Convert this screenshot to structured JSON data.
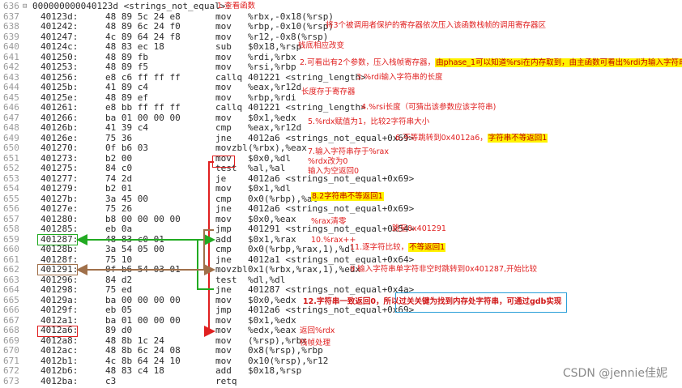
{
  "header": {
    "line": "636",
    "fold": "⊟",
    "text": "000000000040123d <strings_not_equal>:"
  },
  "rows": [
    {
      "ln": "637",
      "addr": "40123d:",
      "bytes": "48 89 5c 24 e8",
      "mn": "mov",
      "op": "%rbx,-0x18(%rsp)"
    },
    {
      "ln": "638",
      "addr": "401242:",
      "bytes": "48 89 6c 24 f0",
      "mn": "mov",
      "op": "%rbp,-0x10(%rsp)"
    },
    {
      "ln": "639",
      "addr": "401247:",
      "bytes": "4c 89 64 24 f8",
      "mn": "mov",
      "op": "%r12,-0x8(%rsp)"
    },
    {
      "ln": "640",
      "addr": "40124c:",
      "bytes": "48 83 ec 18",
      "mn": "sub",
      "op": "$0x18,%rsp"
    },
    {
      "ln": "641",
      "addr": "401250:",
      "bytes": "48 89 fb",
      "mn": "mov",
      "op": "%rdi,%rbx"
    },
    {
      "ln": "642",
      "addr": "401253:",
      "bytes": "48 89 f5",
      "mn": "mov",
      "op": "%rsi,%rbp"
    },
    {
      "ln": "643",
      "addr": "401256:",
      "bytes": "e8 c6 ff ff ff",
      "mn": "callq",
      "op": "401221 <string_length>"
    },
    {
      "ln": "644",
      "addr": "40125b:",
      "bytes": "41 89 c4",
      "mn": "mov",
      "op": "%eax,%r12d"
    },
    {
      "ln": "645",
      "addr": "40125e:",
      "bytes": "48 89 ef",
      "mn": "mov",
      "op": "%rbp,%rdi"
    },
    {
      "ln": "646",
      "addr": "401261:",
      "bytes": "e8 bb ff ff ff",
      "mn": "callq",
      "op": "401221 <string_length>"
    },
    {
      "ln": "647",
      "addr": "401266:",
      "bytes": "ba 01 00 00 00",
      "mn": "mov",
      "op": "$0x1,%edx"
    },
    {
      "ln": "648",
      "addr": "40126b:",
      "bytes": "41 39 c4",
      "mn": "cmp",
      "op": "%eax,%r12d"
    },
    {
      "ln": "649",
      "addr": "40126e:",
      "bytes": "75 36",
      "mn": "jne",
      "op": "4012a6 <strings_not_equal+0x69>"
    },
    {
      "ln": "650",
      "addr": "401270:",
      "bytes": "0f b6 03",
      "mn": "movzbl",
      "op": "(%rbx),%eax"
    },
    {
      "ln": "651",
      "addr": "401273:",
      "bytes": "b2 00",
      "mn": "mov",
      "op": "$0x0,%dl"
    },
    {
      "ln": "652",
      "addr": "401275:",
      "bytes": "84 c0",
      "mn": "test",
      "op": "%al,%al"
    },
    {
      "ln": "653",
      "addr": "401277:",
      "bytes": "74 2d",
      "mn": "je",
      "op": "4012a6 <strings_not_equal+0x69>"
    },
    {
      "ln": "654",
      "addr": "401279:",
      "bytes": "b2 01",
      "mn": "mov",
      "op": "$0x1,%dl"
    },
    {
      "ln": "655",
      "addr": "40127b:",
      "bytes": "3a 45 00",
      "mn": "cmp",
      "op": "0x0(%rbp),%al"
    },
    {
      "ln": "656",
      "addr": "40127e:",
      "bytes": "75 26",
      "mn": "jne",
      "op": "4012a6 <strings_not_equal+0x69>"
    },
    {
      "ln": "657",
      "addr": "401280:",
      "bytes": "b8 00 00 00 00",
      "mn": "mov",
      "op": "$0x0,%eax"
    },
    {
      "ln": "658",
      "addr": "401285:",
      "bytes": "eb 0a",
      "mn": "jmp",
      "op": "401291 <strings_not_equal+0x54>"
    },
    {
      "ln": "659",
      "addr": "401287:",
      "bytes": "48 83 c0 01",
      "mn": "add",
      "op": "$0x1,%rax"
    },
    {
      "ln": "660",
      "addr": "40128b:",
      "bytes": "3a 54 05 00",
      "mn": "cmp",
      "op": "0x0(%rbp,%rax,1),%dl"
    },
    {
      "ln": "661",
      "addr": "40128f:",
      "bytes": "75 10",
      "mn": "jne",
      "op": "4012a1 <strings_not_equal+0x64>"
    },
    {
      "ln": "662",
      "addr": "401291:",
      "bytes": "0f b6 54 03 01",
      "mn": "movzbl",
      "op": "0x1(%rbx,%rax,1),%edx"
    },
    {
      "ln": "663",
      "addr": "401296:",
      "bytes": "84 d2",
      "mn": "test",
      "op": "%dl,%dl"
    },
    {
      "ln": "664",
      "addr": "401298:",
      "bytes": "75 ed",
      "mn": "jne",
      "op": "401287 <strings_not_equal+0x4a>"
    },
    {
      "ln": "665",
      "addr": "40129a:",
      "bytes": "ba 00 00 00 00",
      "mn": "mov",
      "op": "$0x0,%edx"
    },
    {
      "ln": "666",
      "addr": "40129f:",
      "bytes": "eb 05",
      "mn": "jmp",
      "op": "4012a6 <strings_not_equal+0x69>"
    },
    {
      "ln": "667",
      "addr": "4012a1:",
      "bytes": "ba 01 00 00 00",
      "mn": "mov",
      "op": "$0x1,%edx"
    },
    {
      "ln": "668",
      "addr": "4012a6:",
      "bytes": "89 d0",
      "mn": "mov",
      "op": "%edx,%eax"
    },
    {
      "ln": "669",
      "addr": "4012a8:",
      "bytes": "48 8b 1c 24",
      "mn": "mov",
      "op": "(%rsp),%rbx"
    },
    {
      "ln": "670",
      "addr": "4012ac:",
      "bytes": "48 8b 6c 24 08",
      "mn": "mov",
      "op": "0x8(%rsp),%rbp"
    },
    {
      "ln": "671",
      "addr": "4012b1:",
      "bytes": "4c 8b 64 24 10",
      "mn": "mov",
      "op": "0x10(%rsp),%r12"
    },
    {
      "ln": "672",
      "addr": "4012b6:",
      "bytes": "48 83 c4 18",
      "mn": "add",
      "op": "$0x18,%rsp"
    },
    {
      "ln": "673",
      "addr": "4012ba:",
      "bytes": "c3",
      "mn": "retq",
      "op": ""
    }
  ],
  "annotations": {
    "a1": "1.查看函数",
    "a2": "将3个被调用者保护的寄存器依次压入该函数栈帧的调用寄存器区",
    "a3": "栈底相应改变",
    "a4_pre": "2.可看出有2个参数，压入栈帧寄存器，",
    "a4_hl": "由phase_1可以知道%rsi在内存取到，由主函数可看出%rdi为输入字符串",
    "a5": "3.%rdi输入字符串的长度",
    "a6": "长度存于寄存器",
    "a7": "4.%rsi长度（可猜出该参数应该字符串)",
    "a8": "5.%rdx赋值为1，比较2字符串大小",
    "a9_pre": "6.不等跳转到0x4012a6，",
    "a9_hl": "字符串不等返回1",
    "a10": "7.输入字符串存于%rax",
    "a11": "%rdx改为0",
    "a12": "输入为空返回0",
    "a13": "8.2字符串不等返回1",
    "a14": "%rax清零",
    "a15": "跳至0x401291",
    "a16": "10.%rax++",
    "a17_pre": "11.逐字符比较，",
    "a17_hl": "不等返回1",
    "a18": "9.输入字符串单字符非空时跳转到0x401287,开始比较",
    "a19": "12.字符串一致返回0，所以过关关键为找到内存处字符串，可通过gdb实现",
    "a20": "返回%rdx",
    "a21": "栈帧处理"
  },
  "colors": {
    "annotation": "#e02020",
    "highlight": "#fff200",
    "green": "#22aa22",
    "brown": "#a0704a",
    "blue": "#2a9fd8"
  },
  "watermark": "CSDN @jennie佳妮"
}
